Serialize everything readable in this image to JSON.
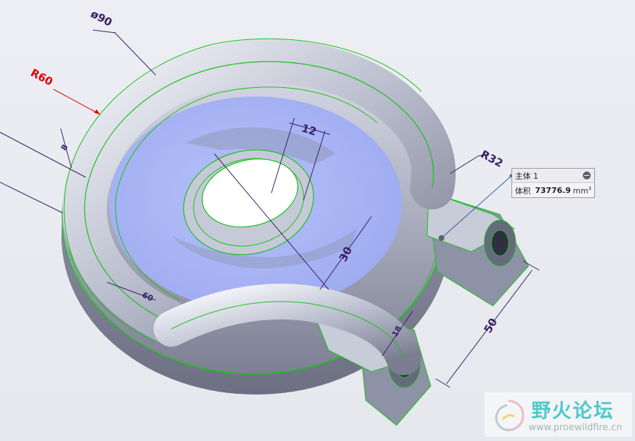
{
  "dimensions": {
    "dia90": "ø90",
    "r60": "R60",
    "small_left": "8",
    "d12": "12",
    "d30": "30",
    "r32": "R32",
    "d50": "50",
    "small_bottom_left": "60",
    "small_bottom_right": "18"
  },
  "callout": {
    "title": "主体 1",
    "volume_label": "体积",
    "volume_value": "73776.9",
    "volume_unit": "mm",
    "volume_unit_exp": "3"
  },
  "watermark": {
    "title": "野火论坛",
    "url": "www.proewildfire.cn"
  },
  "colors": {
    "background": "#e9ebf0",
    "dimension_text": "#3a1f66",
    "highlight_dimension": "#e00000",
    "edge_green": "#19c219",
    "inner_face": "#a9b6f5",
    "body_gray": "#9ea3b4"
  },
  "icons": [
    "collapse-icon",
    "cursor-point-icon",
    "watermark-logo-icon"
  ]
}
